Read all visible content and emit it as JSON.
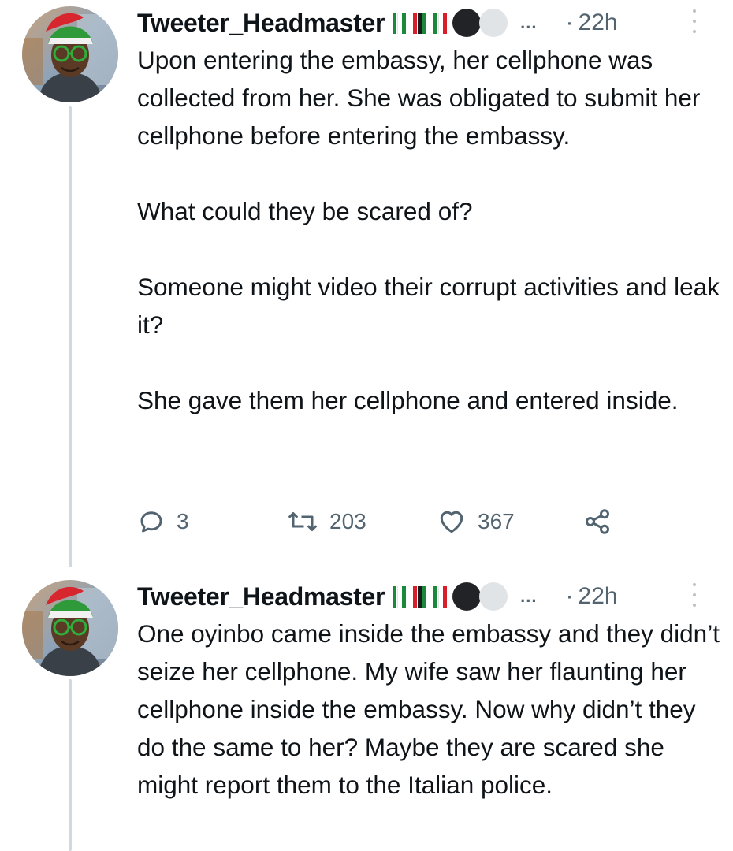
{
  "tweets": [
    {
      "username": "Tweeter_Headmaster",
      "ellipsis": "...",
      "time_separator": "·",
      "time": "22h",
      "avatar_icon": "profile-avatar",
      "paragraphs": [
        "Upon entering the embassy, her cellphone was collected from her. She was obligated to submit her cellphone before entering the embassy.",
        "What could they be scared of?",
        "Someone might video their corrupt activities and leak it?",
        "She gave them her cellphone and entered inside."
      ],
      "actions": {
        "reply_count": "3",
        "retweet_count": "203",
        "like_count": "367"
      }
    },
    {
      "username": "Tweeter_Headmaster",
      "ellipsis": "...",
      "time_separator": "·",
      "time": "22h",
      "avatar_icon": "profile-avatar",
      "paragraphs": [
        "One oyinbo came inside the embassy and they didn’t seize her cellphone. My wife saw her flaunting her cellphone inside the embassy. Now why didn’t they do the same to her? Maybe they are scared she might report them to the Italian police."
      ]
    }
  ],
  "colors": {
    "text": "#0f1419",
    "secondary": "#536471",
    "thread_line": "#cfd9de",
    "flag_green": "#1a8a3a",
    "flag_red": "#d81e2b"
  },
  "icons": [
    "reply-icon",
    "retweet-icon",
    "like-icon",
    "share-icon",
    "more-options-icon"
  ]
}
